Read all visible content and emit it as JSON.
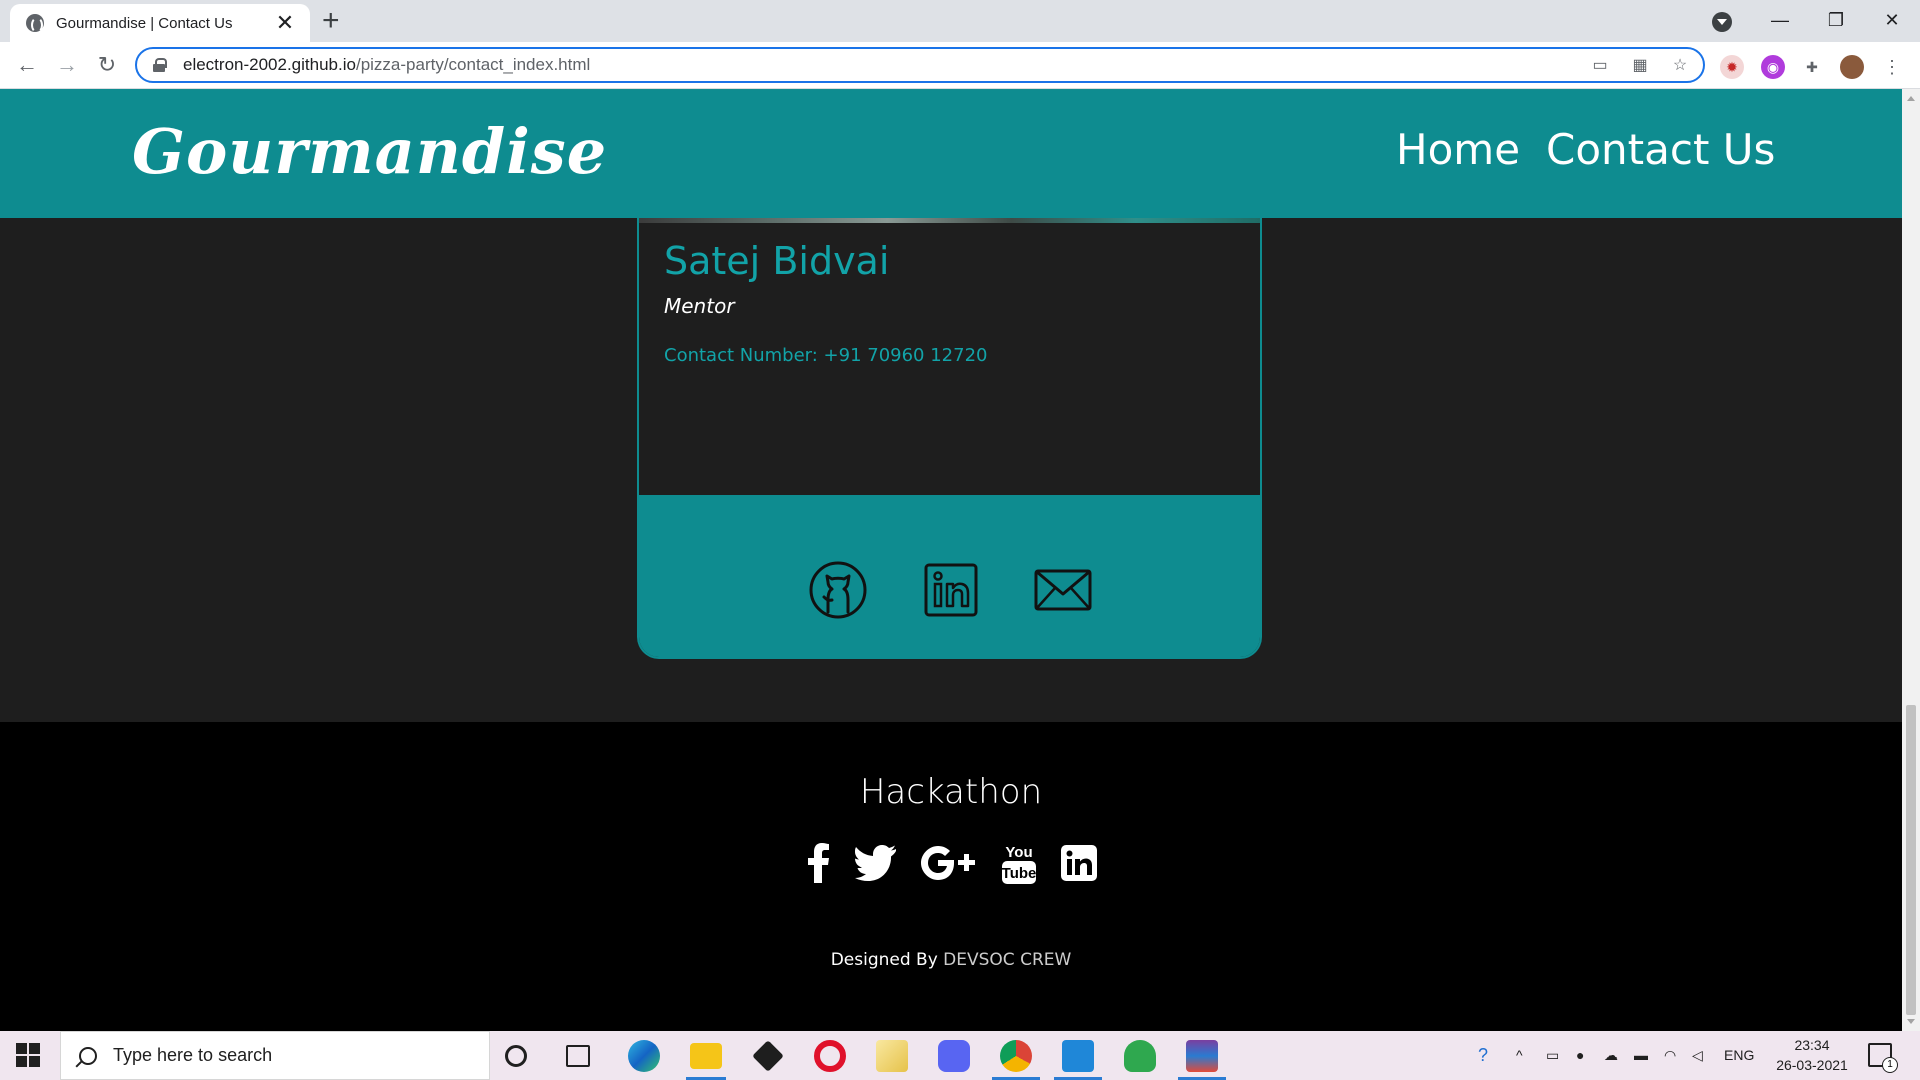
{
  "browser": {
    "tab_title": "Gourmandise | Contact Us",
    "tab_close": "✕",
    "new_tab": "+",
    "url_host": "electron-2002.github.io",
    "url_path": "/pizza-party/contact_index.html"
  },
  "site": {
    "brand": "Gourmandise",
    "nav": [
      {
        "label": "Home"
      },
      {
        "label": "Contact Us"
      }
    ]
  },
  "card": {
    "name": "Satej Bidvai",
    "role": "Mentor",
    "contact": "Contact Number: +91 70960 12720",
    "social_icons": [
      "github-icon",
      "linkedin-icon",
      "mail-icon"
    ]
  },
  "footer": {
    "title": "Hackathon",
    "social_icons": [
      "facebook-icon",
      "twitter-icon",
      "google-plus-icon",
      "youtube-icon",
      "linkedin-icon"
    ],
    "credit_prefix": "Designed By",
    "credit_name": "DEVSOC CREW"
  },
  "taskbar": {
    "search_placeholder": "Type here to search",
    "language": "ENG",
    "time": "23:34",
    "date": "26-03-2021",
    "notification_count": "1"
  },
  "colors": {
    "accent": "#0e8c90",
    "accent_text": "#12a3a8",
    "page_bg": "#1e1e1e",
    "footer_bg": "#000000"
  }
}
